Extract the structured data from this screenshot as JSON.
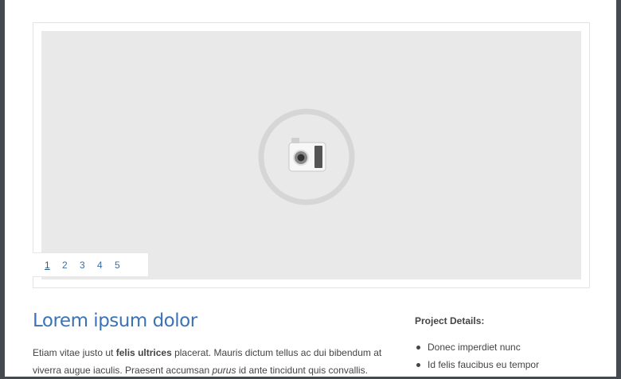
{
  "slider": {
    "pages": [
      "1",
      "2",
      "3",
      "4",
      "5"
    ],
    "active_page": "1",
    "placeholder_icon": "camera-icon"
  },
  "article": {
    "title": "Lorem ipsum dolor",
    "paragraph": {
      "part1": "Etiam vitae justo ut ",
      "bold": "felis ultrices",
      "part2": " placerat. Mauris dictum tellus ac dui bibendum at viverra augue iaculis. Praesent accumsan ",
      "italic": "purus",
      "part3": " id ante tincidunt quis convallis."
    }
  },
  "project_details": {
    "heading": "Project Details:",
    "items": [
      "Donec imperdiet nunc",
      "Id felis faucibus eu tempor"
    ]
  }
}
